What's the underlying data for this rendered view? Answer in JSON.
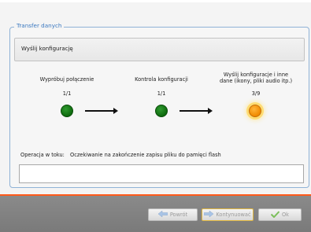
{
  "window": {
    "group_title": "Transfer danych",
    "header_text": "Wyślij konfigurację"
  },
  "steps": [
    {
      "label": "Wypróbuj połączenie",
      "count": "1/1",
      "status": "done"
    },
    {
      "label": "Kontrola konfiguracji",
      "count": "1/1",
      "status": "done"
    },
    {
      "label_line1": "Wyślij konfiguracje i inne",
      "label_line2": "dane (ikony, pliki audio itp.)",
      "count": "3/9",
      "status": "active"
    }
  ],
  "operation": {
    "label": "Operacja w toku:",
    "text": "Oczekiwanie na zakończenie zapisu pliku do pamięci flash",
    "log": ""
  },
  "buttons": {
    "back_label": "Powrót",
    "continue_label": "Kontynuować",
    "ok_label": "Ok"
  },
  "icons": {
    "back": "arrow-left-icon",
    "continue": "arrow-right-icon",
    "ok": "check-icon"
  },
  "colors": {
    "accent_orange": "#ff5a1a",
    "done_green": "#1a7a1a",
    "active_orange": "#f5a000",
    "title_blue": "#3a78c0"
  }
}
